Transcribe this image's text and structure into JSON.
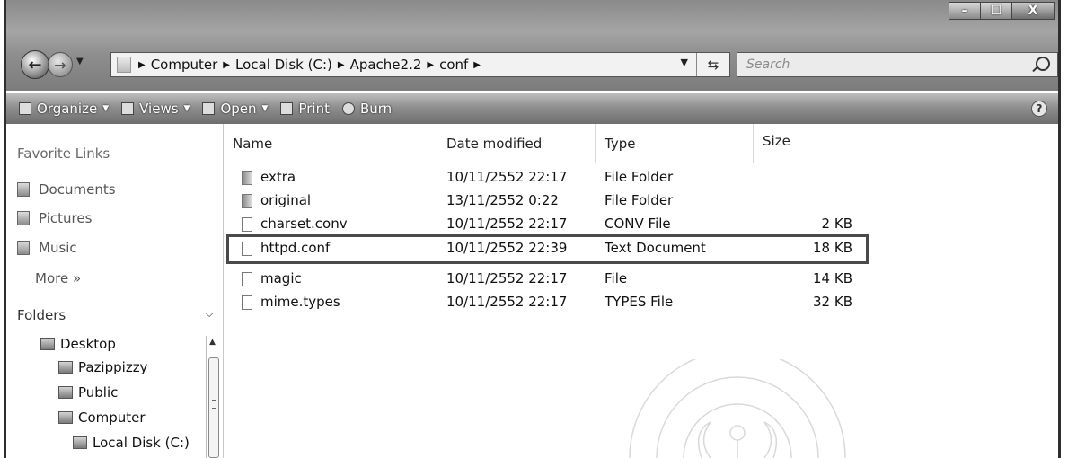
{
  "window": {
    "caption_buttons": {
      "minimize": "–",
      "maximize": "☐",
      "close": "X"
    }
  },
  "nav": {
    "back_icon": "back-arrow-icon",
    "forward_icon": "forward-arrow-icon",
    "breadcrumbs": [
      "Computer",
      "Local Disk (C:)",
      "Apache2.2",
      "conf"
    ],
    "search_placeholder": "Search"
  },
  "toolbar": {
    "organize": "Organize",
    "views": "Views",
    "open": "Open",
    "print": "Print",
    "burn": "Burn",
    "help": "?"
  },
  "sidebar": {
    "favorite_heading": "Favorite Links",
    "favorites": [
      "Documents",
      "Pictures",
      "Music"
    ],
    "more": "More »",
    "folders_heading": "Folders",
    "tree": [
      "Desktop",
      "Pazippizzy",
      "Public",
      "Computer",
      "Local Disk (C:)"
    ]
  },
  "columns": [
    "Name",
    "Date modified",
    "Type",
    "Size"
  ],
  "files": [
    {
      "name": "extra",
      "date": "10/11/2552 22:17",
      "type": "File Folder",
      "size": "",
      "kind": "folder"
    },
    {
      "name": "original",
      "date": "13/11/2552 0:22",
      "type": "File Folder",
      "size": "",
      "kind": "folder"
    },
    {
      "name": "charset.conv",
      "date": "10/11/2552 22:17",
      "type": "CONV File",
      "size": "2 KB",
      "kind": "file"
    },
    {
      "name": "httpd.conf",
      "date": "10/11/2552 22:39",
      "type": "Text Document",
      "size": "18 KB",
      "kind": "file"
    },
    {
      "name": "magic",
      "date": "10/11/2552 22:17",
      "type": "File",
      "size": "14 KB",
      "kind": "file"
    },
    {
      "name": "mime.types",
      "date": "10/11/2552 22:17",
      "type": "TYPES File",
      "size": "32 KB",
      "kind": "file"
    }
  ],
  "highlighted_file": "httpd.conf"
}
